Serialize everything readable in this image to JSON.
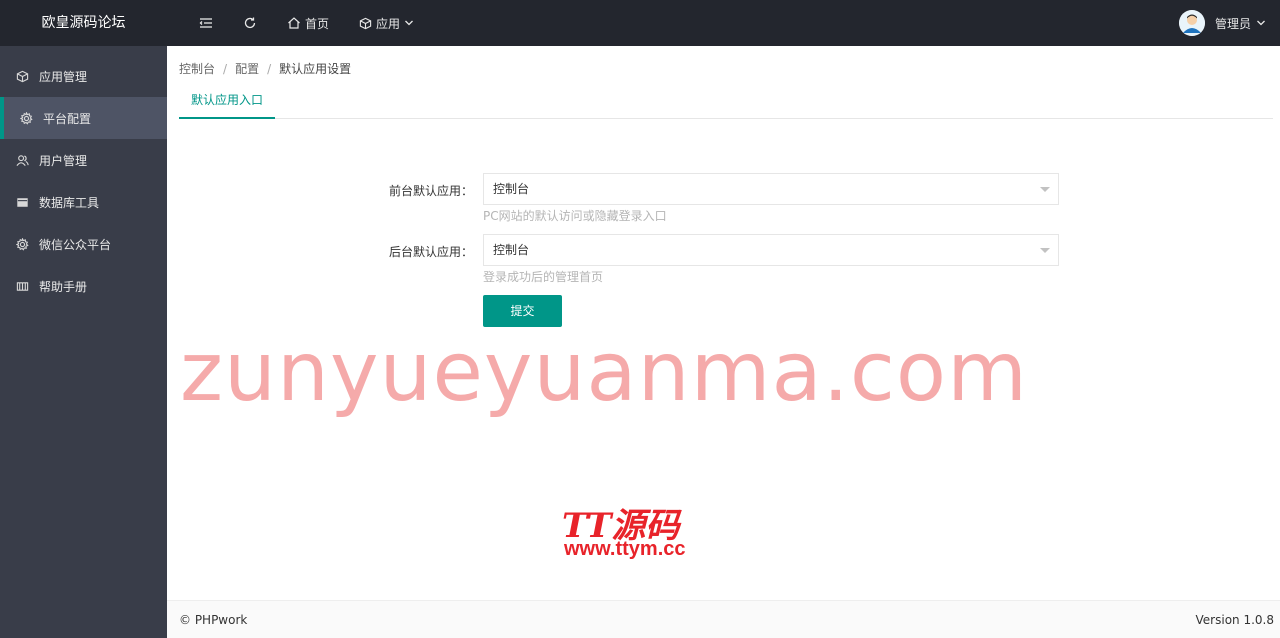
{
  "header": {
    "brand": "欧皇源码论坛",
    "nav": {
      "home_label": "首页",
      "apps_label": "应用"
    },
    "user": {
      "name": "管理员"
    }
  },
  "sidebar": {
    "items": [
      {
        "label": "应用管理",
        "icon": "cube-icon"
      },
      {
        "label": "平台配置",
        "icon": "gear-icon"
      },
      {
        "label": "用户管理",
        "icon": "users-icon"
      },
      {
        "label": "数据库工具",
        "icon": "database-icon"
      },
      {
        "label": "微信公众平台",
        "icon": "gear-icon"
      },
      {
        "label": "帮助手册",
        "icon": "book-icon"
      }
    ],
    "active_index": 1
  },
  "breadcrumb": [
    "控制台",
    "配置",
    "默认应用设置"
  ],
  "tabs": [
    {
      "label": "默认应用入口"
    }
  ],
  "form": {
    "frontend": {
      "label": "前台默认应用：",
      "value": "控制台",
      "hint": "PC网站的默认访问或隐藏登录入口"
    },
    "backend": {
      "label": "后台默认应用：",
      "value": "控制台",
      "hint": "登录成功后的管理首页"
    },
    "submit_label": "提交"
  },
  "watermark": {
    "text": "zunyueyuanma.com",
    "logo_title": "TT源码",
    "logo_url": "www.ttym.cc"
  },
  "footer": {
    "copyright": "© PHPwork",
    "version": "Version 1.0.8"
  },
  "colors": {
    "accent": "#009688",
    "topbar": "#23262e",
    "sidebar": "#393d49"
  }
}
